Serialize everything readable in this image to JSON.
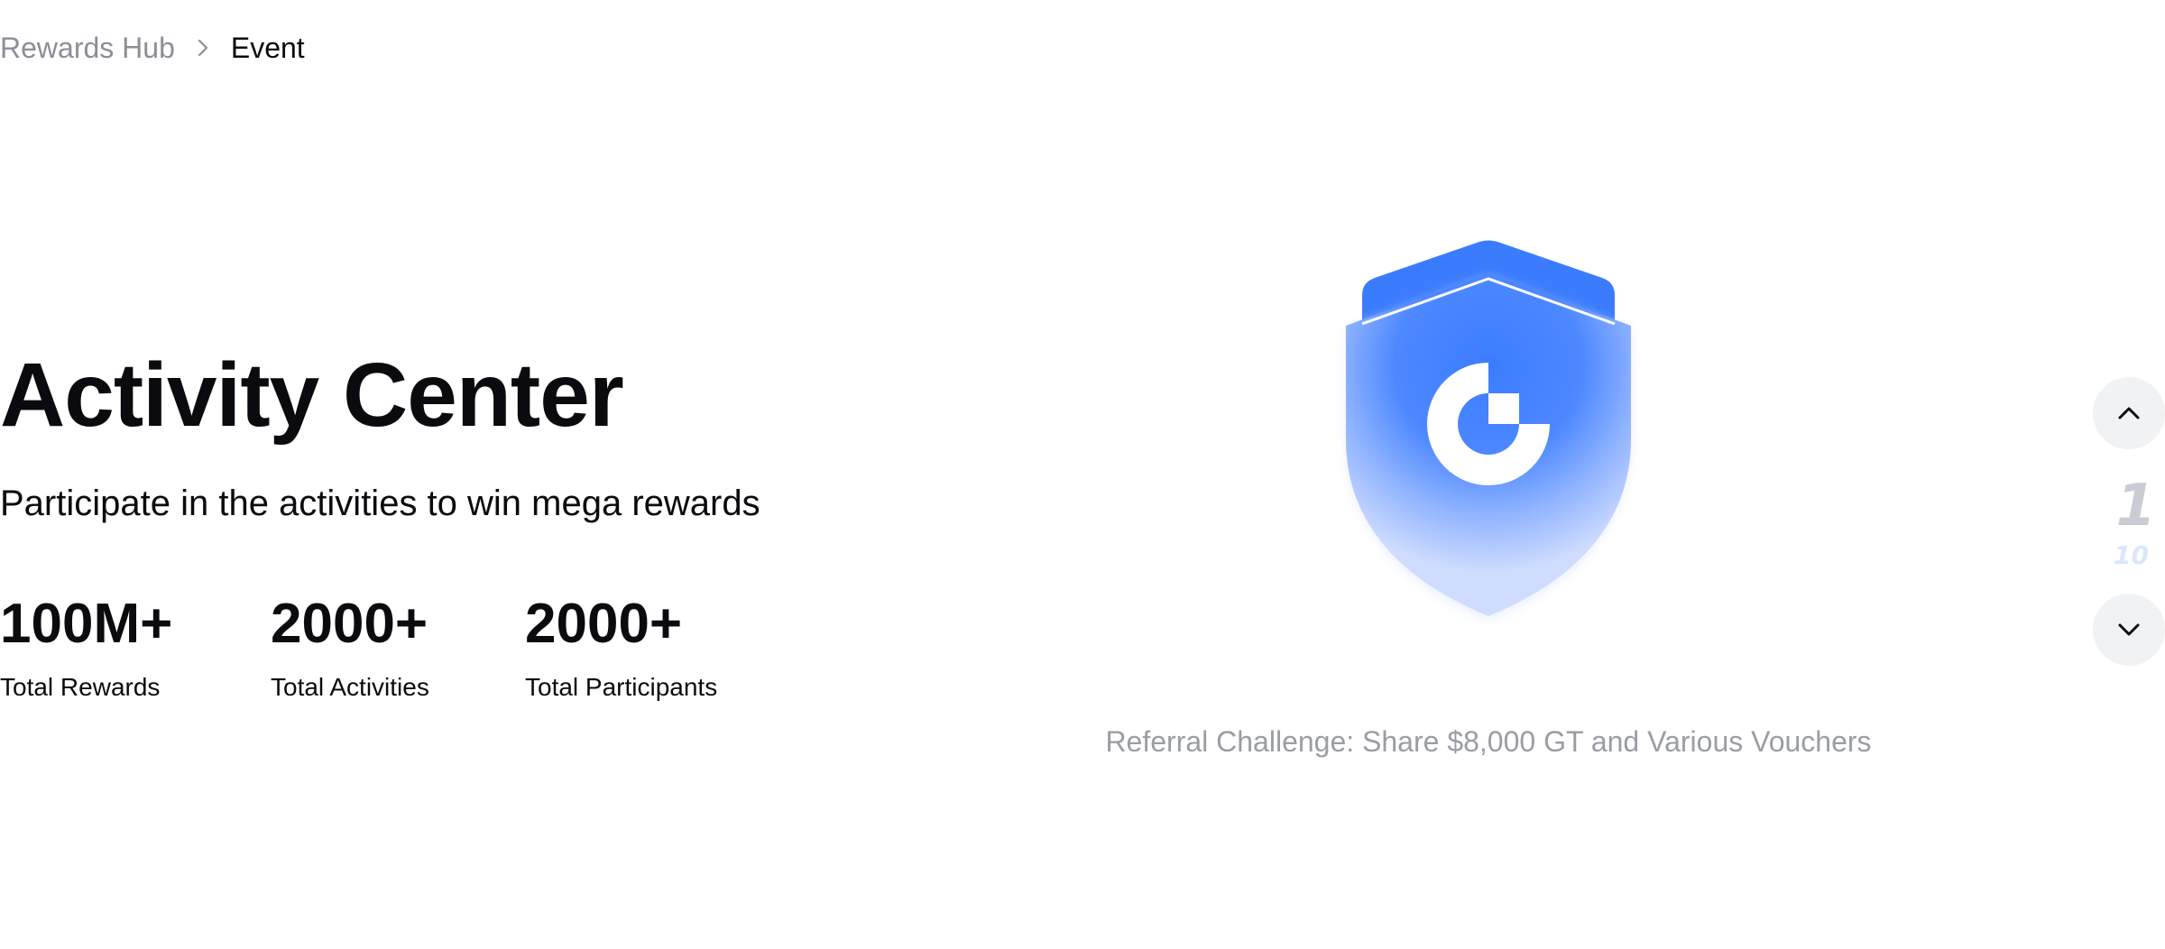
{
  "breadcrumb": {
    "parent": "Rewards Hub",
    "separator_icon": "chevron-right-icon",
    "current": "Event"
  },
  "hero": {
    "title": "Activity Center",
    "subtitle": "Participate in the activities to win mega rewards"
  },
  "stats": [
    {
      "value": "100M+",
      "label": "Total Rewards"
    },
    {
      "value": "2000+",
      "label": "Total Activities"
    },
    {
      "value": "2000+",
      "label": "Total Participants"
    }
  ],
  "banner": {
    "icon": "shield-logo-icon",
    "caption": "Referral Challenge: Share $8,000 GT and Various Vouchers"
  },
  "pager": {
    "up_icon": "chevron-up-icon",
    "down_icon": "chevron-down-icon",
    "current": "1",
    "total": "10"
  },
  "colors": {
    "brand_blue": "#3b7cff",
    "text_primary": "#0b0b0f",
    "text_muted": "#8b8e96",
    "pager_bg": "#f1f2f4"
  }
}
